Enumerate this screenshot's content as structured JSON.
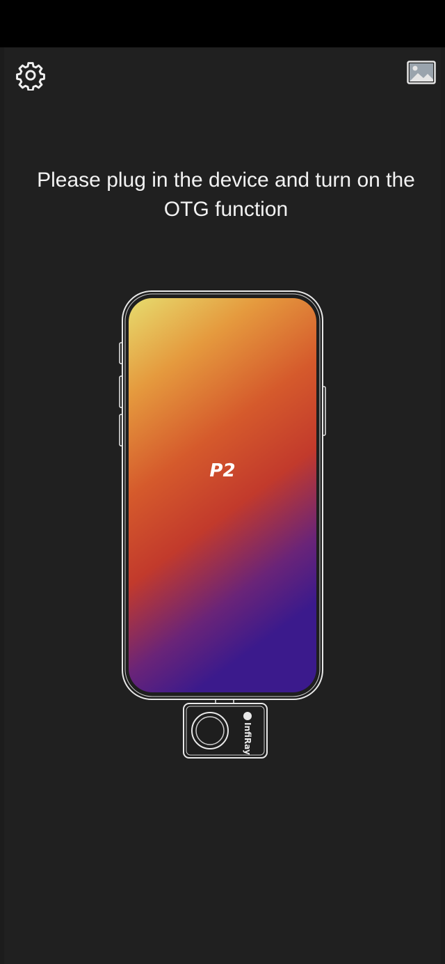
{
  "header": {
    "settings_icon": "gear-icon",
    "gallery_icon": "image-icon"
  },
  "main": {
    "instruction": "Please plug in the device and turn on the OTG function",
    "device_model": "P2",
    "brand_logo": "InfiRay"
  },
  "colors": {
    "background": "#202020",
    "status_bar": "#000000",
    "text": "#f2f2f2",
    "gradient": [
      "#e6dc6e",
      "#e59a3e",
      "#d55a2c",
      "#c23a2c",
      "#6a2478",
      "#3b1a8c"
    ]
  }
}
